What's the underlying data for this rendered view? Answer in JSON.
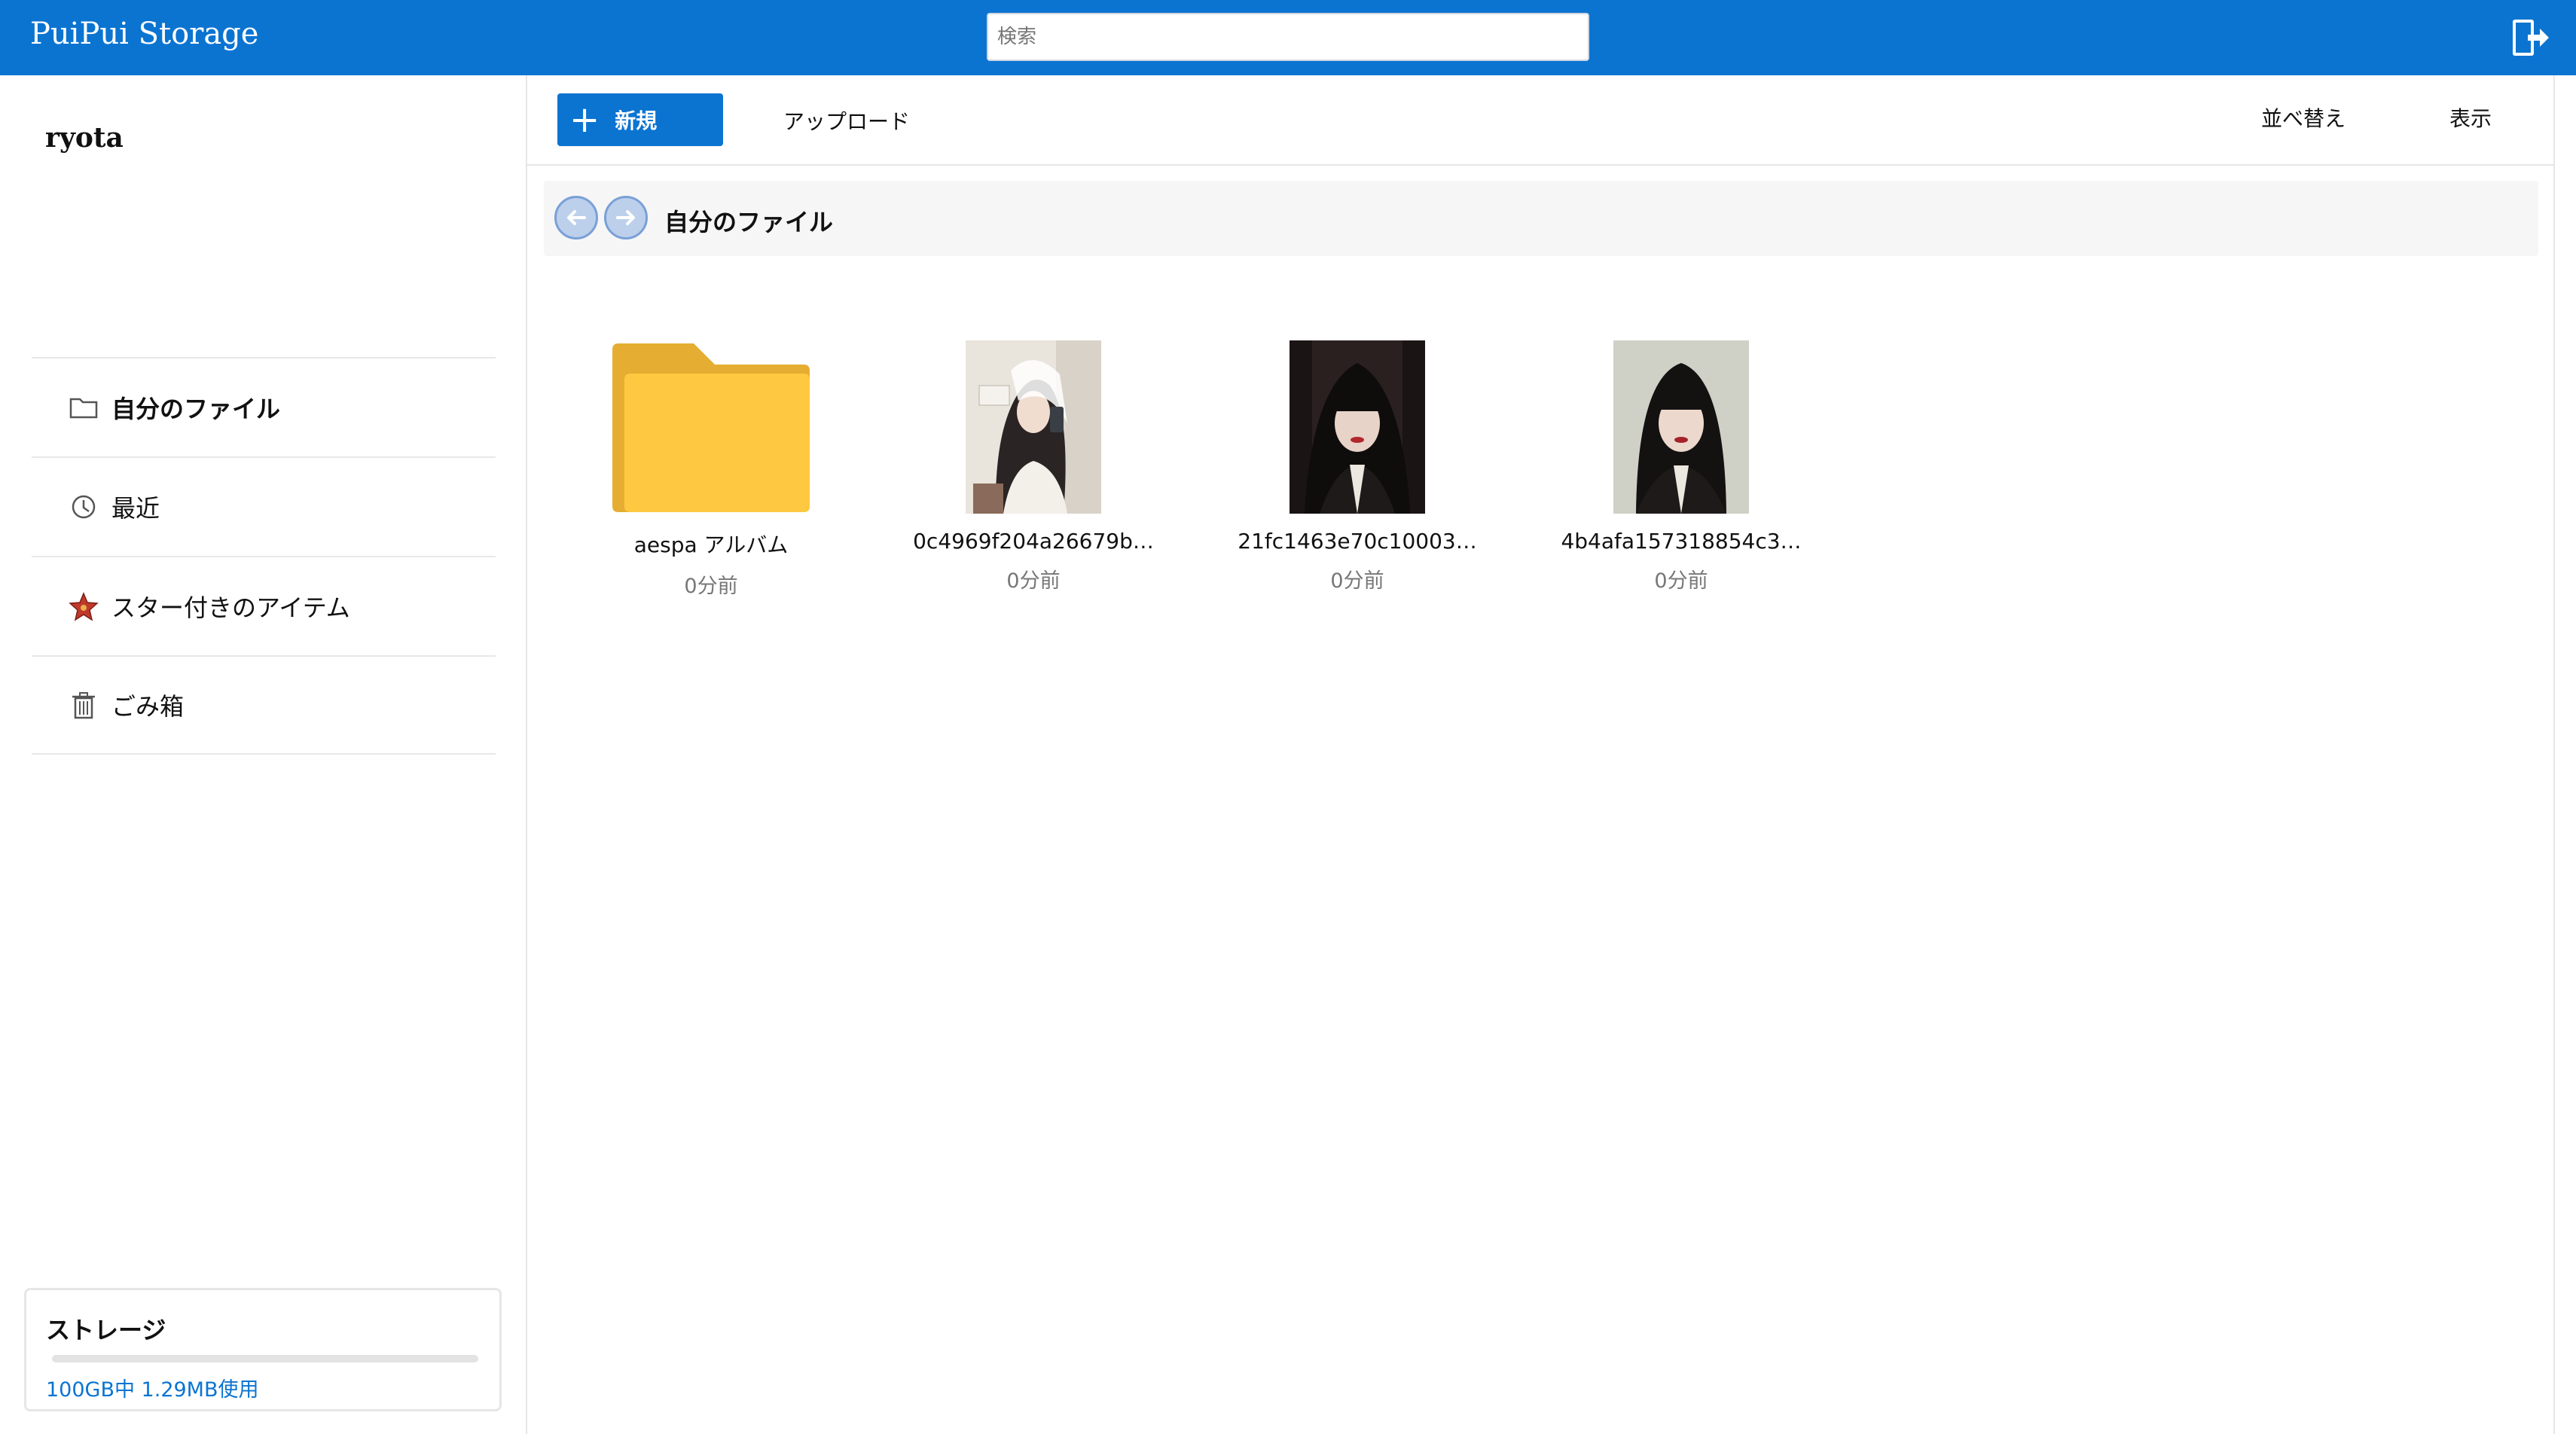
{
  "header": {
    "brand": "PuiPui Storage",
    "search_placeholder": "検索",
    "logout_icon": "logout-door-icon",
    "bg_color": "#0b74d1"
  },
  "sidebar": {
    "username": "ryota",
    "items": [
      {
        "label": "自分のファイル",
        "icon": "folder-icon",
        "active": true
      },
      {
        "label": "最近",
        "icon": "history-icon",
        "active": false
      },
      {
        "label": "スター付きのアイテム",
        "icon": "star-icon",
        "active": false
      },
      {
        "label": "ごみ箱",
        "icon": "trash-icon",
        "active": false
      }
    ],
    "storage": {
      "title": "ストレージ",
      "usage_text": "100GB中 1.29MB使用",
      "used_fraction": 1.29e-05
    }
  },
  "toolbar": {
    "new_label": "新規",
    "upload_label": "アップロード",
    "sort_label": "並べ替え",
    "view_label": "表示"
  },
  "breadcrumb": {
    "title": "自分のファイル"
  },
  "files": [
    {
      "name": "aespa アルバム",
      "time": "0分前",
      "type": "folder"
    },
    {
      "name": "0c4969f204a26679b…",
      "time": "0分前",
      "type": "image"
    },
    {
      "name": "21fc1463e70c10003…",
      "time": "0分前",
      "type": "image"
    },
    {
      "name": "4b4afa157318854c3…",
      "time": "0分前",
      "type": "image"
    }
  ]
}
